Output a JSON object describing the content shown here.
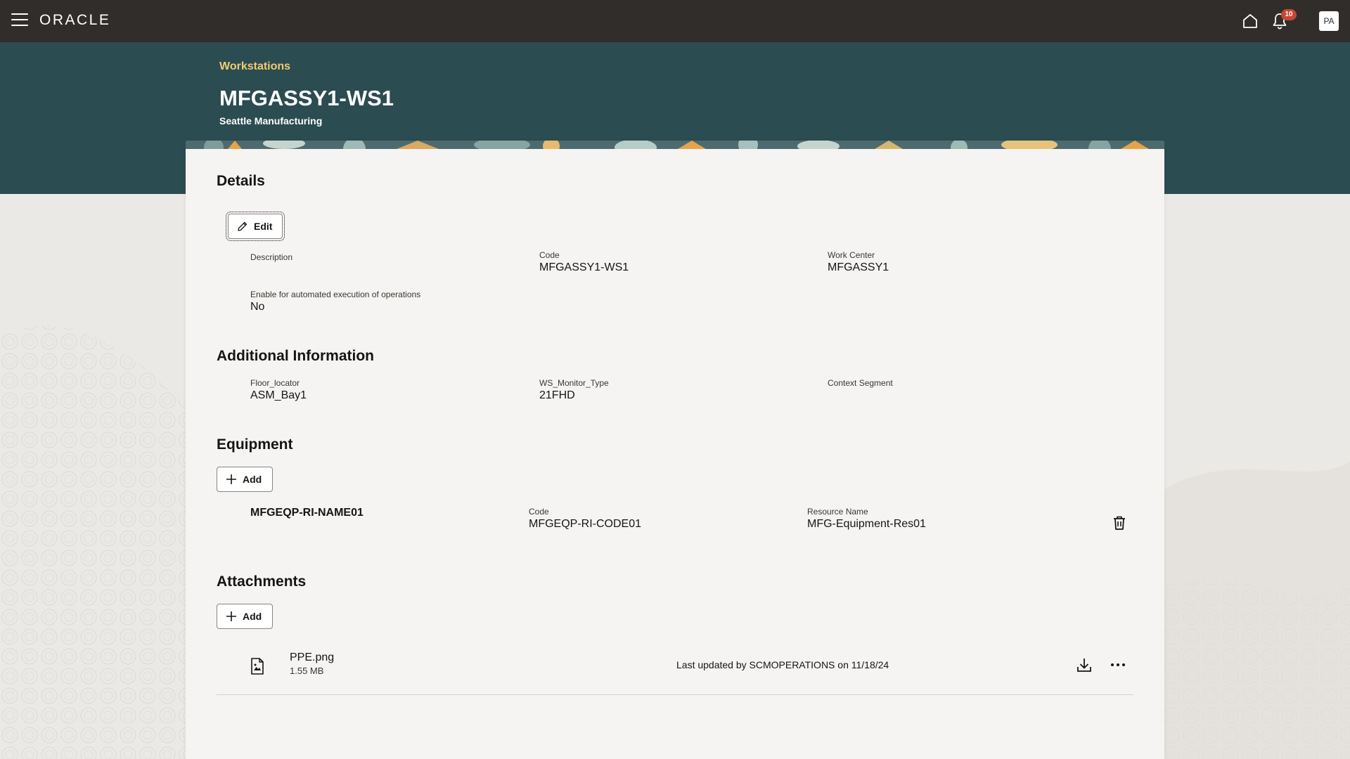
{
  "topbar": {
    "brand": "ORACLE",
    "notification_count": "10",
    "avatar_initials": "PA"
  },
  "header": {
    "breadcrumb": "Workstations",
    "title": "MFGASSY1-WS1",
    "subtitle": "Seattle Manufacturing"
  },
  "details": {
    "title": "Details",
    "edit_label": "Edit",
    "description_label": "Description",
    "code_label": "Code",
    "code_value": "MFGASSY1-WS1",
    "work_center_label": "Work Center",
    "work_center_value": "MFGASSY1",
    "automated_label": "Enable for automated execution of operations",
    "automated_value": "No"
  },
  "additional": {
    "title": "Additional Information",
    "floor_label": "Floor_locator",
    "floor_value": "ASM_Bay1",
    "monitor_label": "WS_Monitor_Type",
    "monitor_value": "21FHD",
    "context_label": "Context Segment"
  },
  "equipment": {
    "title": "Equipment",
    "add_label": "Add",
    "items": [
      {
        "name": "MFGEQP-RI-NAME01",
        "code_label": "Code",
        "code_value": "MFGEQP-RI-CODE01",
        "resource_label": "Resource Name",
        "resource_value": "MFG-Equipment-Res01"
      }
    ]
  },
  "attachments": {
    "title": "Attachments",
    "add_label": "Add",
    "items": [
      {
        "file_name": "PPE.png",
        "file_size": "1.55 MB",
        "updated_text": "Last updated by SCMOPERATIONS on 11/18/24"
      }
    ]
  },
  "colors": {
    "topbar": "#312d2a",
    "band": "#2b4c51",
    "breadcrumb": "#f0cc71",
    "badge": "#c74634",
    "card": "#f5f4f2"
  }
}
